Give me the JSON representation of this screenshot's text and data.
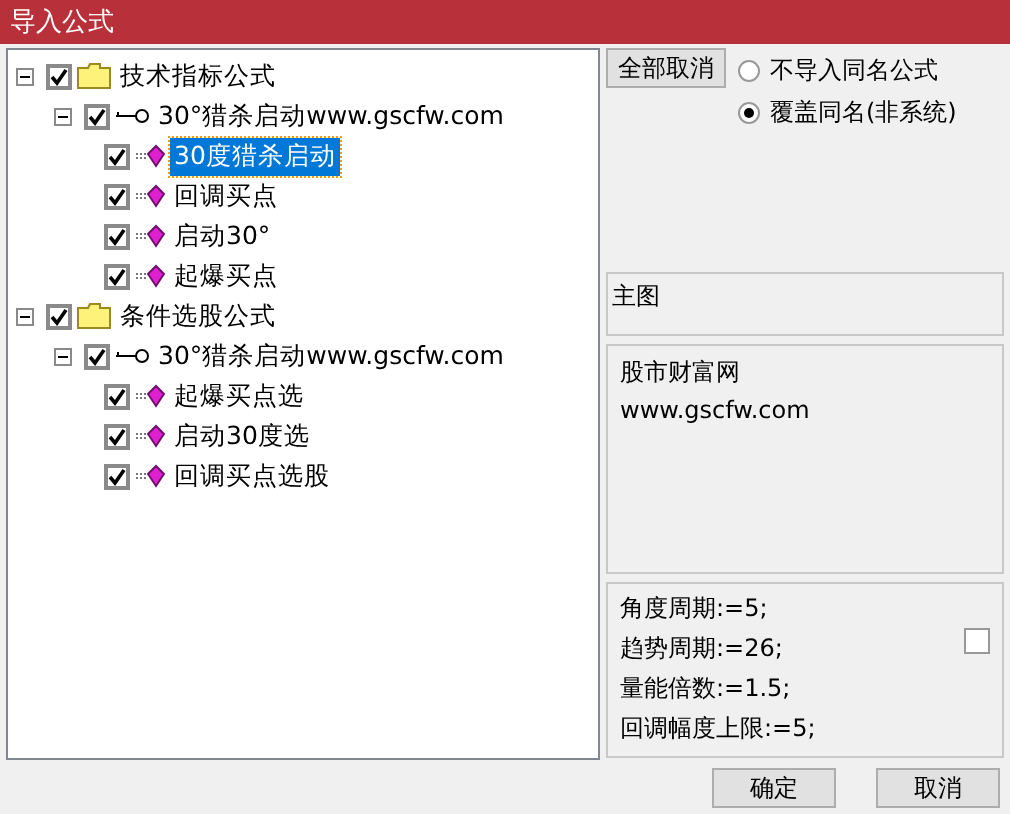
{
  "window": {
    "title": "导入公式"
  },
  "tree": [
    {
      "label": "技术指标公式",
      "kind": "folder",
      "checked": true,
      "expanded": true,
      "selected": false,
      "children": [
        {
          "label": "30°猎杀启动www.gscfw.com",
          "kind": "package",
          "checked": true,
          "expanded": true,
          "selected": false,
          "children": [
            {
              "label": "30度猎杀启动",
              "kind": "formula",
              "checked": true,
              "selected": true
            },
            {
              "label": "回调买点",
              "kind": "formula",
              "checked": true,
              "selected": false
            },
            {
              "label": "启动30°",
              "kind": "formula",
              "checked": true,
              "selected": false
            },
            {
              "label": "起爆买点",
              "kind": "formula",
              "checked": true,
              "selected": false
            }
          ]
        }
      ]
    },
    {
      "label": "条件选股公式",
      "kind": "folder",
      "checked": true,
      "expanded": true,
      "selected": false,
      "children": [
        {
          "label": "30°猎杀启动www.gscfw.com",
          "kind": "package",
          "checked": true,
          "expanded": true,
          "selected": false,
          "children": [
            {
              "label": "起爆买点选",
              "kind": "formula",
              "checked": true,
              "selected": false
            },
            {
              "label": "启动30度选",
              "kind": "formula",
              "checked": true,
              "selected": false
            },
            {
              "label": "回调买点选股",
              "kind": "formula",
              "checked": true,
              "selected": false
            }
          ]
        }
      ]
    }
  ],
  "cancel_all_button": "全部取消",
  "options": [
    {
      "label": "不导入同名公式",
      "selected": false
    },
    {
      "label": "覆盖同名(非系统)",
      "selected": true
    }
  ],
  "chart_type": "主图",
  "description": [
    "股市财富网",
    "www.gscfw.com"
  ],
  "parameters": {
    "lines": [
      "角度周期:=5;",
      "趋势周期:=26;",
      "量能倍数:=1.5;",
      "回调幅度上限:=5;"
    ],
    "checked": false
  },
  "buttons": [
    "确定",
    "取消"
  ]
}
